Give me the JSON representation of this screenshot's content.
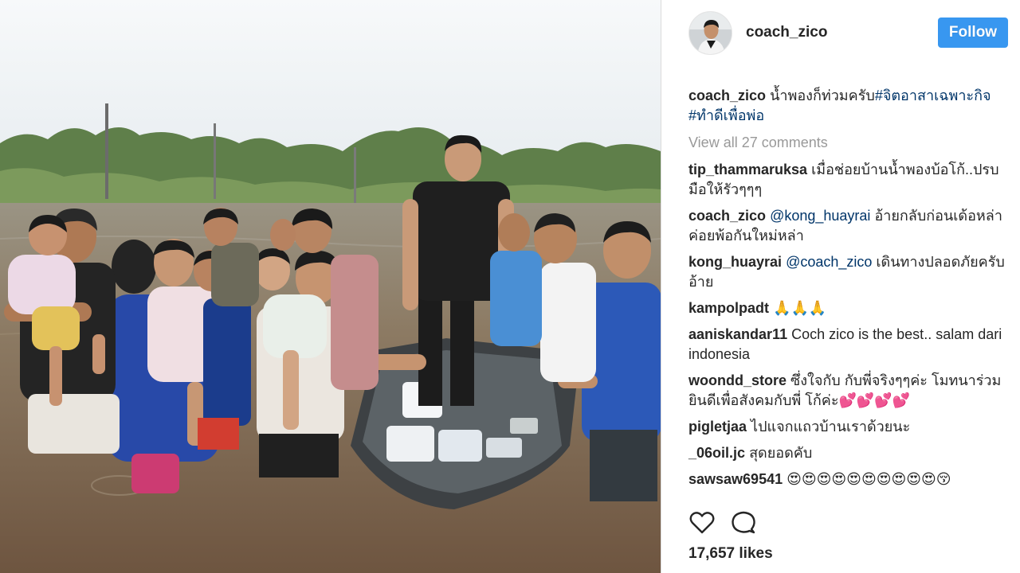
{
  "photo": {
    "alt_icon": "flood-relief-photo"
  },
  "header": {
    "username": "coach_zico",
    "follow_label": "Follow",
    "avatar_icon": "avatar-icon"
  },
  "caption": {
    "username": "coach_zico",
    "text": "น้ำพองก็ท่วมครับ",
    "hashtag_1": "#จิตอาสาเฉพาะกิจ",
    "hashtag_2": "#ทำดีเพื่อพ่อ"
  },
  "view_all_comments": "View all 27 comments",
  "comments": [
    {
      "username": "tip_thammaruksa",
      "mention": "",
      "text": "เมื่อช่อยบ้านน้ำพองบ้อโก้..ปรบมือให้รัวๆๆๆ"
    },
    {
      "username": "coach_zico",
      "mention": "@kong_huayrai",
      "text": "อ้ายกลับก่อนเด้อหล่า ค่อยพ้อกันใหม่หล่า"
    },
    {
      "username": "kong_huayrai",
      "mention": "@coach_zico",
      "text": "เดินทางปลอดภัยครับอ้าย"
    },
    {
      "username": "kampolpadt",
      "mention": "",
      "text": "🙏🙏🙏"
    },
    {
      "username": "aaniskandar11",
      "mention": "",
      "text": "Coch zico is the best.. salam dari indonesia"
    },
    {
      "username": "woondd_store",
      "mention": "",
      "text": "ซึ่งใจกับ กับพี่จริงๆๆค่ะ โมทนาร่วมยินดีเพื่อสังคมกับพี่ โก้ค่ะ💕💕💕💕"
    },
    {
      "username": "pigletjaa",
      "mention": "",
      "text": "ไปแจกแถวบ้านเราด้วยนะ"
    },
    {
      "username": "_06oil.jc",
      "mention": "",
      "text": "สุดยอดคับ"
    },
    {
      "username": "sawsaw69541",
      "mention": "",
      "text": "😍😍😍😍😍😍😍😍😍😍😚"
    }
  ],
  "actions": {
    "like_icon": "heart-icon",
    "comment_icon": "comment-icon"
  },
  "likes_text": "17,657 likes",
  "colors": {
    "follow_bg": "#3897f0",
    "link": "#003569",
    "muted": "#999999",
    "text": "#262626"
  }
}
